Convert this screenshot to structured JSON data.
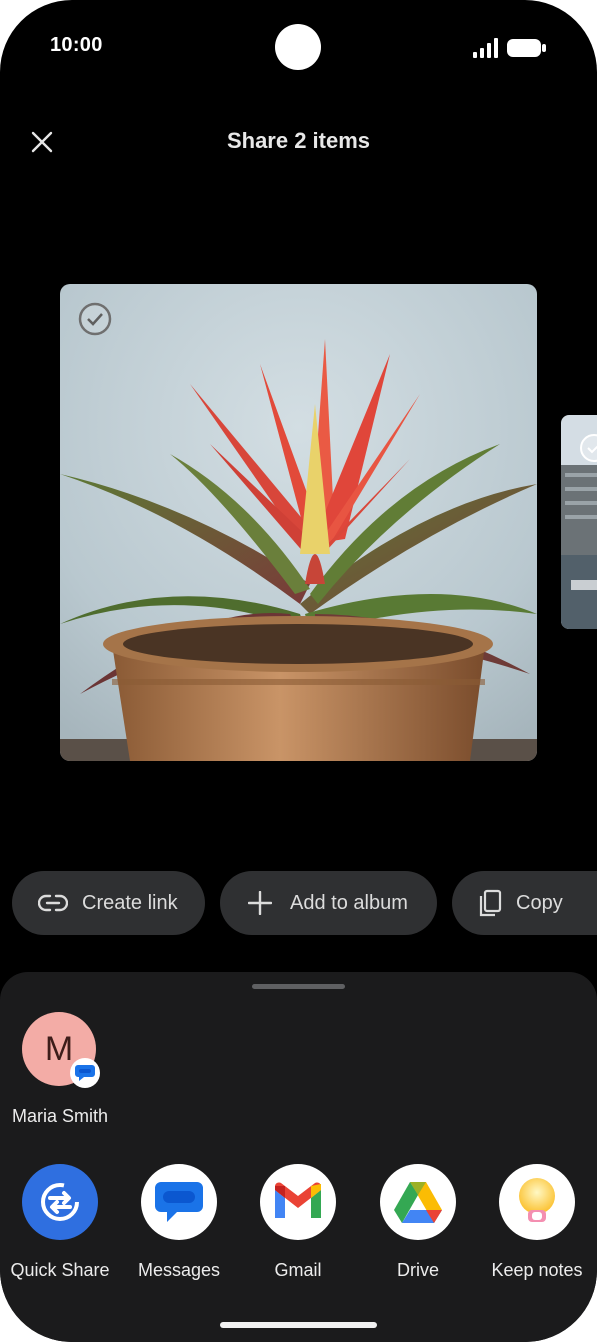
{
  "status_bar": {
    "time": "10:00"
  },
  "header": {
    "title": "Share 2 items",
    "close_icon": "close-icon"
  },
  "photos": [
    {
      "subject": "potted bromeliad plant",
      "selected": true
    },
    {
      "subject": "waterfront buildings",
      "selected": true
    }
  ],
  "actions": [
    {
      "label": "Create link",
      "icon": "link-icon"
    },
    {
      "label": "Add to album",
      "icon": "plus-icon"
    },
    {
      "label": "Copy",
      "icon": "copy-icon"
    }
  ],
  "contacts": [
    {
      "name": "Maria Smith",
      "initial": "M",
      "avatar_color": "#f3aca6",
      "badge": "messages-badge-icon"
    }
  ],
  "apps": [
    {
      "label": "Quick Share",
      "icon": "quick-share-icon"
    },
    {
      "label": "Messages",
      "icon": "messages-icon"
    },
    {
      "label": "Gmail",
      "icon": "gmail-icon"
    },
    {
      "label": "Drive",
      "icon": "drive-icon"
    },
    {
      "label": "Keep notes",
      "icon": "keep-notes-icon"
    }
  ],
  "colors": {
    "background": "#000000",
    "sheet": "#1b1b1c",
    "chip": "#2f3032",
    "accent_blue": "#1a73e8"
  }
}
